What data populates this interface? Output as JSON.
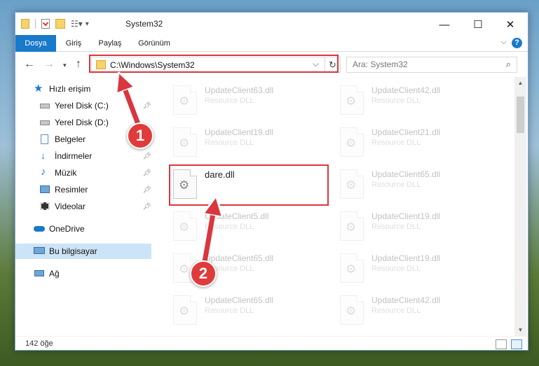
{
  "window": {
    "title": "System32",
    "minimize": "—",
    "maximize": "☐",
    "close": "✕"
  },
  "ribbon": {
    "tabs": [
      "Dosya",
      "Giriş",
      "Paylaş",
      "Görünüm"
    ],
    "help": "?"
  },
  "nav": {
    "back": "←",
    "forward": "→",
    "up": "↑",
    "address": "C:\\Windows\\System32",
    "search_placeholder": "Ara: System32"
  },
  "sidebar": {
    "items": [
      {
        "label": "Hızlı erişim",
        "icon": "star-icon"
      },
      {
        "label": "Yerel Disk (C:)",
        "icon": "drive-icon"
      },
      {
        "label": "Yerel Disk (D:)",
        "icon": "drive-icon"
      },
      {
        "label": "Belgeler",
        "icon": "documents-icon"
      },
      {
        "label": "İndirmeler",
        "icon": "downloads-icon"
      },
      {
        "label": "Müzik",
        "icon": "music-icon"
      },
      {
        "label": "Resimler",
        "icon": "pictures-icon"
      },
      {
        "label": "Videolar",
        "icon": "videos-icon"
      },
      {
        "label": "OneDrive",
        "icon": "cloud-icon"
      },
      {
        "label": "Bu bilgisayar",
        "icon": "computer-icon"
      },
      {
        "label": "Ağ",
        "icon": "network-icon"
      }
    ]
  },
  "files": [
    {
      "name": "UpdateClient63.dll",
      "type": "Resource DLL"
    },
    {
      "name": "UpdateClient42.dll",
      "type": "Resource DLL"
    },
    {
      "name": "UpdateClient19.dll",
      "type": "Resource DLL"
    },
    {
      "name": "UpdateClient21.dll",
      "type": "Resource DLL"
    },
    {
      "name": "dare.dll",
      "type": ""
    },
    {
      "name": "UpdateClient65.dll",
      "type": "Resource DLL"
    },
    {
      "name": "UpdateClient5.dll",
      "type": "Resource DLL"
    },
    {
      "name": "UpdateClient19.dll",
      "type": "Resource DLL"
    },
    {
      "name": "UpdateClient65.dll",
      "type": "Resource DLL"
    },
    {
      "name": "UpdateClient19.dll",
      "type": "Resource DLL"
    },
    {
      "name": "UpdateClient65.dll",
      "type": "Resource DLL"
    },
    {
      "name": "UpdateClient42.dll",
      "type": "Resource DLL"
    }
  ],
  "status": {
    "count": "142 öğe"
  },
  "annotations": {
    "step1": "1",
    "step2": "2",
    "color": "#d9363e"
  }
}
